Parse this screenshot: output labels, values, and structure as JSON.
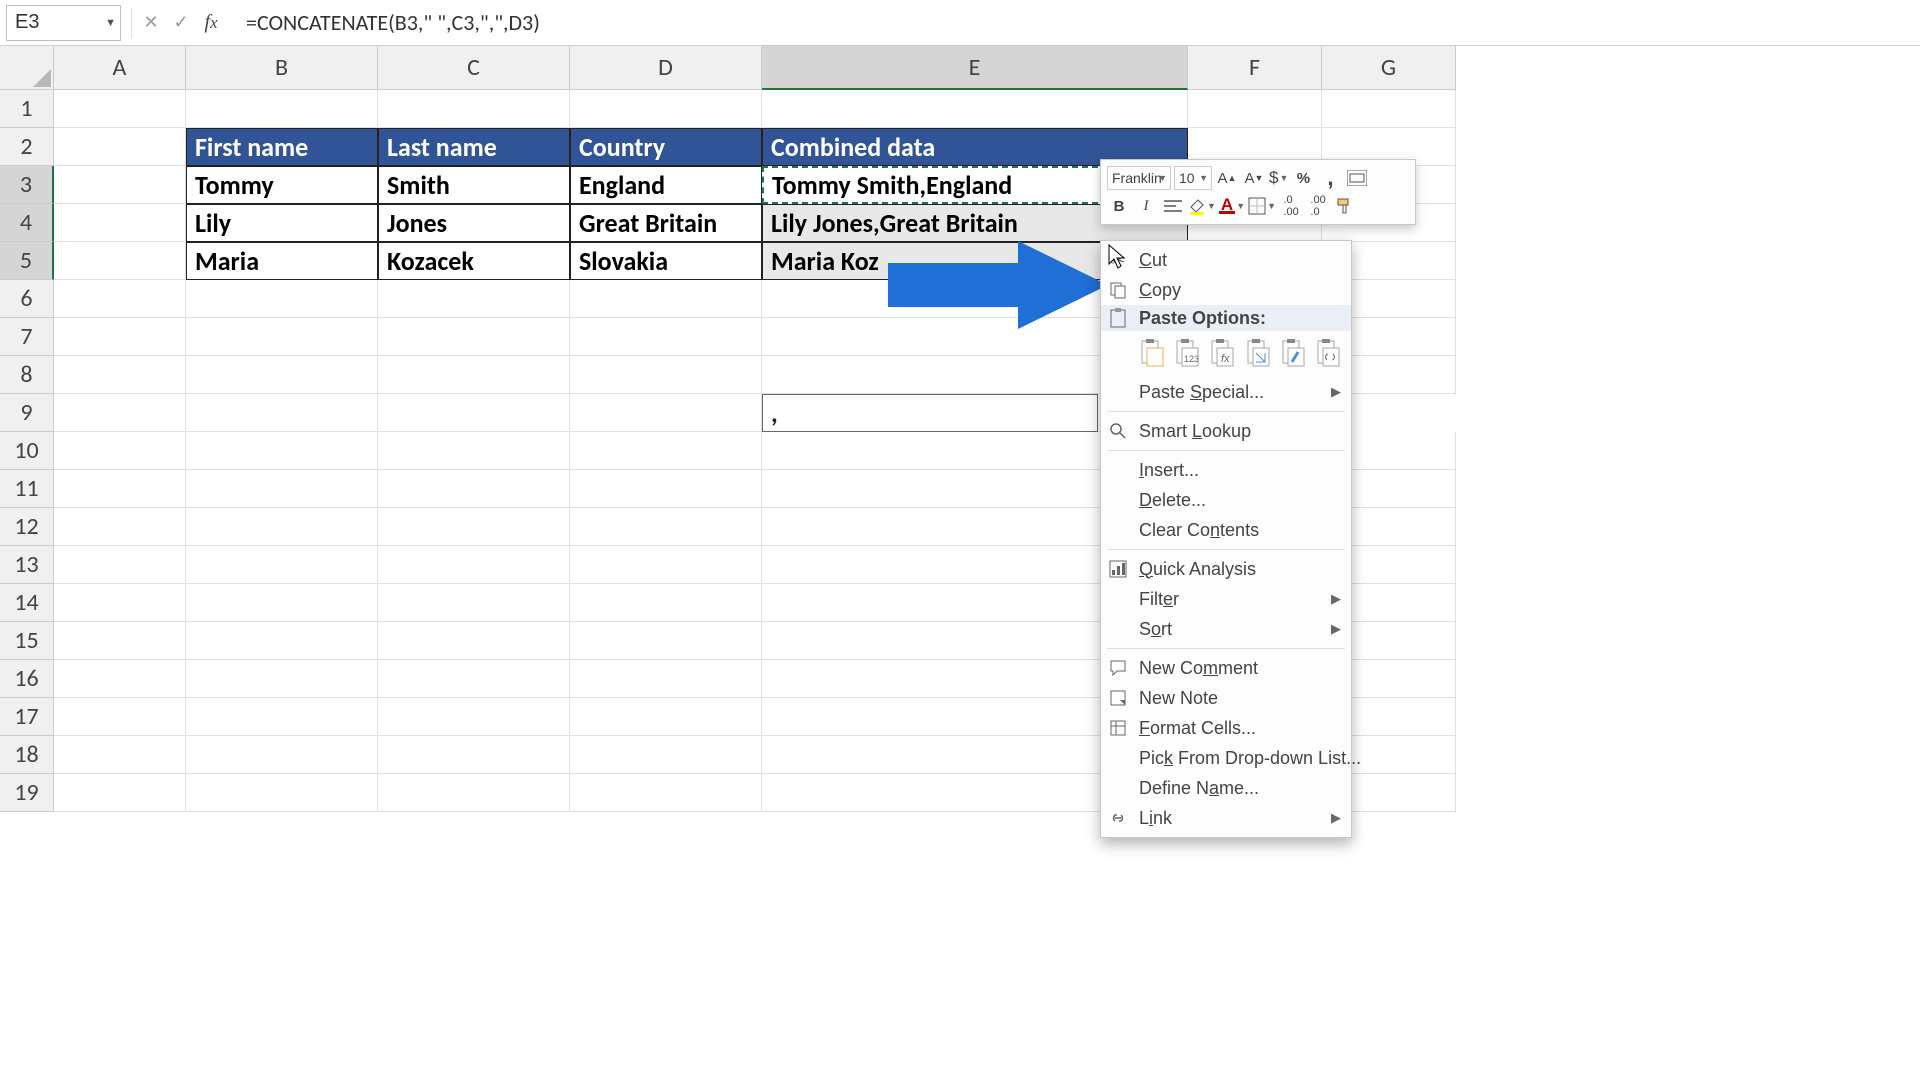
{
  "namebox": "E3",
  "formula": "=CONCATENATE(B3,\" \",C3,\",\",D3)",
  "columns": [
    "A",
    "B",
    "C",
    "D",
    "E",
    "F",
    "G"
  ],
  "row_numbers": [
    1,
    2,
    3,
    4,
    5,
    6,
    7,
    8,
    9,
    10,
    11,
    12,
    13,
    14,
    15,
    16,
    17,
    18,
    19
  ],
  "headers": {
    "b": "First name",
    "c": "Last name",
    "d": "Country",
    "e": "Combined data"
  },
  "rows": [
    {
      "b": "Tommy",
      "c": "Smith",
      "d": "England",
      "e": "Tommy Smith,England"
    },
    {
      "b": "Lily",
      "c": "Jones",
      "d": "Great Britain",
      "e": "Lily  Jones,Great Britain"
    },
    {
      "b": "Maria",
      "c": "Kozacek",
      "d": "Slovakia",
      "e": "Maria Koz"
    }
  ],
  "e9": " ,",
  "mini": {
    "font": "Franklin",
    "size": "10"
  },
  "ctx": {
    "cut": "Cut",
    "copy": "Copy",
    "paste_hdr": "Paste Options:",
    "paste_special": "Paste Special...",
    "smart": "Smart Lookup",
    "insert": "Insert...",
    "delete": "Delete...",
    "clear": "Clear Contents",
    "quick": "Quick Analysis",
    "filter": "Filter",
    "sort": "Sort",
    "comment": "New Comment",
    "note": "New Note",
    "format": "Format Cells...",
    "pick": "Pick From Drop-down List...",
    "define": "Define Name...",
    "link": "Link"
  }
}
